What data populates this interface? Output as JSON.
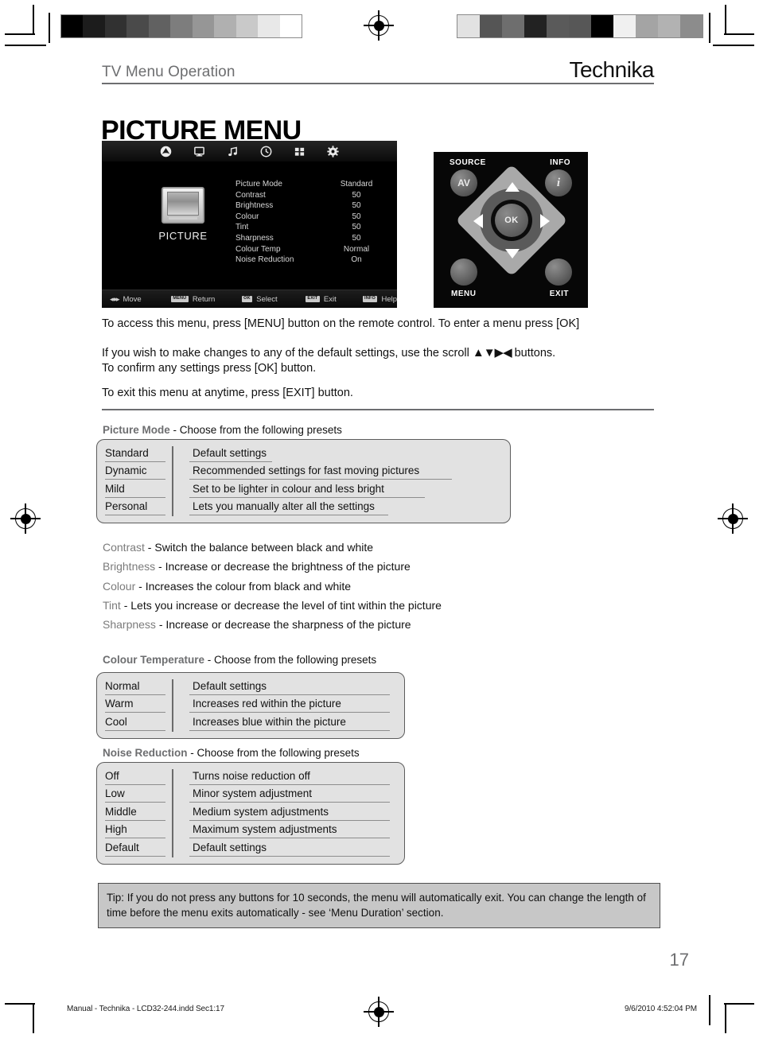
{
  "header": {
    "section_title": "TV Menu Operation",
    "brand": "Technika",
    "page_title": "PICTURE MENU"
  },
  "osd": {
    "icons": [
      "picture-icon",
      "screen-icon",
      "sound-icon",
      "time-icon",
      "option-icon",
      "setup-icon"
    ],
    "panel_label": "PICTURE",
    "settings": [
      {
        "label": "Picture Mode",
        "value": "Standard"
      },
      {
        "label": "Contrast",
        "value": "50"
      },
      {
        "label": "Brightness",
        "value": "50"
      },
      {
        "label": "Colour",
        "value": "50"
      },
      {
        "label": "Tint",
        "value": "50"
      },
      {
        "label": "Sharpness",
        "value": "50"
      },
      {
        "label": "Colour Temp",
        "value": "Normal"
      },
      {
        "label": "Noise Reduction",
        "value": "On"
      }
    ],
    "footer": [
      {
        "key": "",
        "action": "Move"
      },
      {
        "key": "MENU",
        "action": "Return"
      },
      {
        "key": "OK",
        "action": "Select"
      },
      {
        "key": "EXIT",
        "action": "Exit"
      },
      {
        "key": "INFO",
        "action": "Help"
      }
    ]
  },
  "remote": {
    "source_label": "SOURCE",
    "source_button": "AV",
    "info_label": "INFO",
    "info_button": "i",
    "ok_button": "OK",
    "menu_label": "MENU",
    "exit_label": "EXIT"
  },
  "intro": {
    "p1": "To access this menu, press [MENU] button on the remote control. To enter a menu press [OK]",
    "p2_before": "If you wish to make changes to any of the default settings, use the scroll",
    "p2_arrows": "▲▼▶◀",
    "p2_after": "buttons.",
    "p2_line2": "To confirm any settings press [OK] button.",
    "p3": "To exit this menu at anytime, press [EXIT] button."
  },
  "picture_mode_table": {
    "caption_term": "Picture Mode",
    "caption_desc": " - Choose from the following presets",
    "rows": [
      {
        "key": "Standard",
        "desc": "Default settings"
      },
      {
        "key": "Dynamic",
        "desc": "Recommended settings for fast moving pictures"
      },
      {
        "key": "Mild",
        "desc": "Set to be lighter in colour and less bright"
      },
      {
        "key": "Personal",
        "desc": "Lets you manually alter all the settings"
      }
    ]
  },
  "definitions": [
    {
      "term": "Contrast",
      "desc": " - Switch the balance between black and white"
    },
    {
      "term": "Brightness",
      "desc": " - Increase or decrease the brightness of the picture"
    },
    {
      "term": "Colour",
      "desc": " - Increases the colour from black and white"
    },
    {
      "term": "Tint",
      "desc": " - Lets you increase or decrease the level of tint within the picture"
    },
    {
      "term": "Sharpness",
      "desc": " - Increase or decrease the sharpness of the picture"
    }
  ],
  "colour_temp_table": {
    "caption_term": "Colour Temperature",
    "caption_desc": " - Choose from the following presets",
    "rows": [
      {
        "key": "Normal",
        "desc": "Default settings"
      },
      {
        "key": "Warm",
        "desc": "Increases red within the picture"
      },
      {
        "key": "Cool",
        "desc": "Increases blue within the picture"
      }
    ]
  },
  "noise_reduction_table": {
    "caption_term": "Noise Reduction",
    "caption_desc": " - Choose from the following presets",
    "rows": [
      {
        "key": "Off",
        "desc": "Turns noise reduction off"
      },
      {
        "key": "Low",
        "desc": "Minor system adjustment"
      },
      {
        "key": "Middle",
        "desc": "Medium system adjustments"
      },
      {
        "key": "High",
        "desc": "Maximum system adjustments"
      },
      {
        "key": "Default",
        "desc": "Default settings"
      }
    ]
  },
  "tip": {
    "text": "Tip: If you do not press any buttons for 10 seconds, the menu will automatically exit. You can change the length of time before the menu exits automatically - see ‘Menu Duration’ section."
  },
  "footer": {
    "page_number": "17",
    "file_info": "Manual - Technika - LCD32-244.indd   Sec1:17",
    "timestamp": "9/6/2010   4:52:04 PM"
  },
  "calibration": {
    "left_strip": [
      "#000000",
      "#1c1c1c",
      "#313131",
      "#4a4a4a",
      "#616161",
      "#7d7d7d",
      "#969696",
      "#b0b0b0",
      "#c9c9c9",
      "#e8e8e8",
      "#ffffff"
    ],
    "right_strip": [
      "#e2e2e2",
      "#555555",
      "#6e6e6e",
      "#222222",
      "#5a5a5a",
      "#575757",
      "#000000",
      "#f0f0f0",
      "#a4a4a4",
      "#b2b2b2",
      "#8c8c8c"
    ]
  }
}
